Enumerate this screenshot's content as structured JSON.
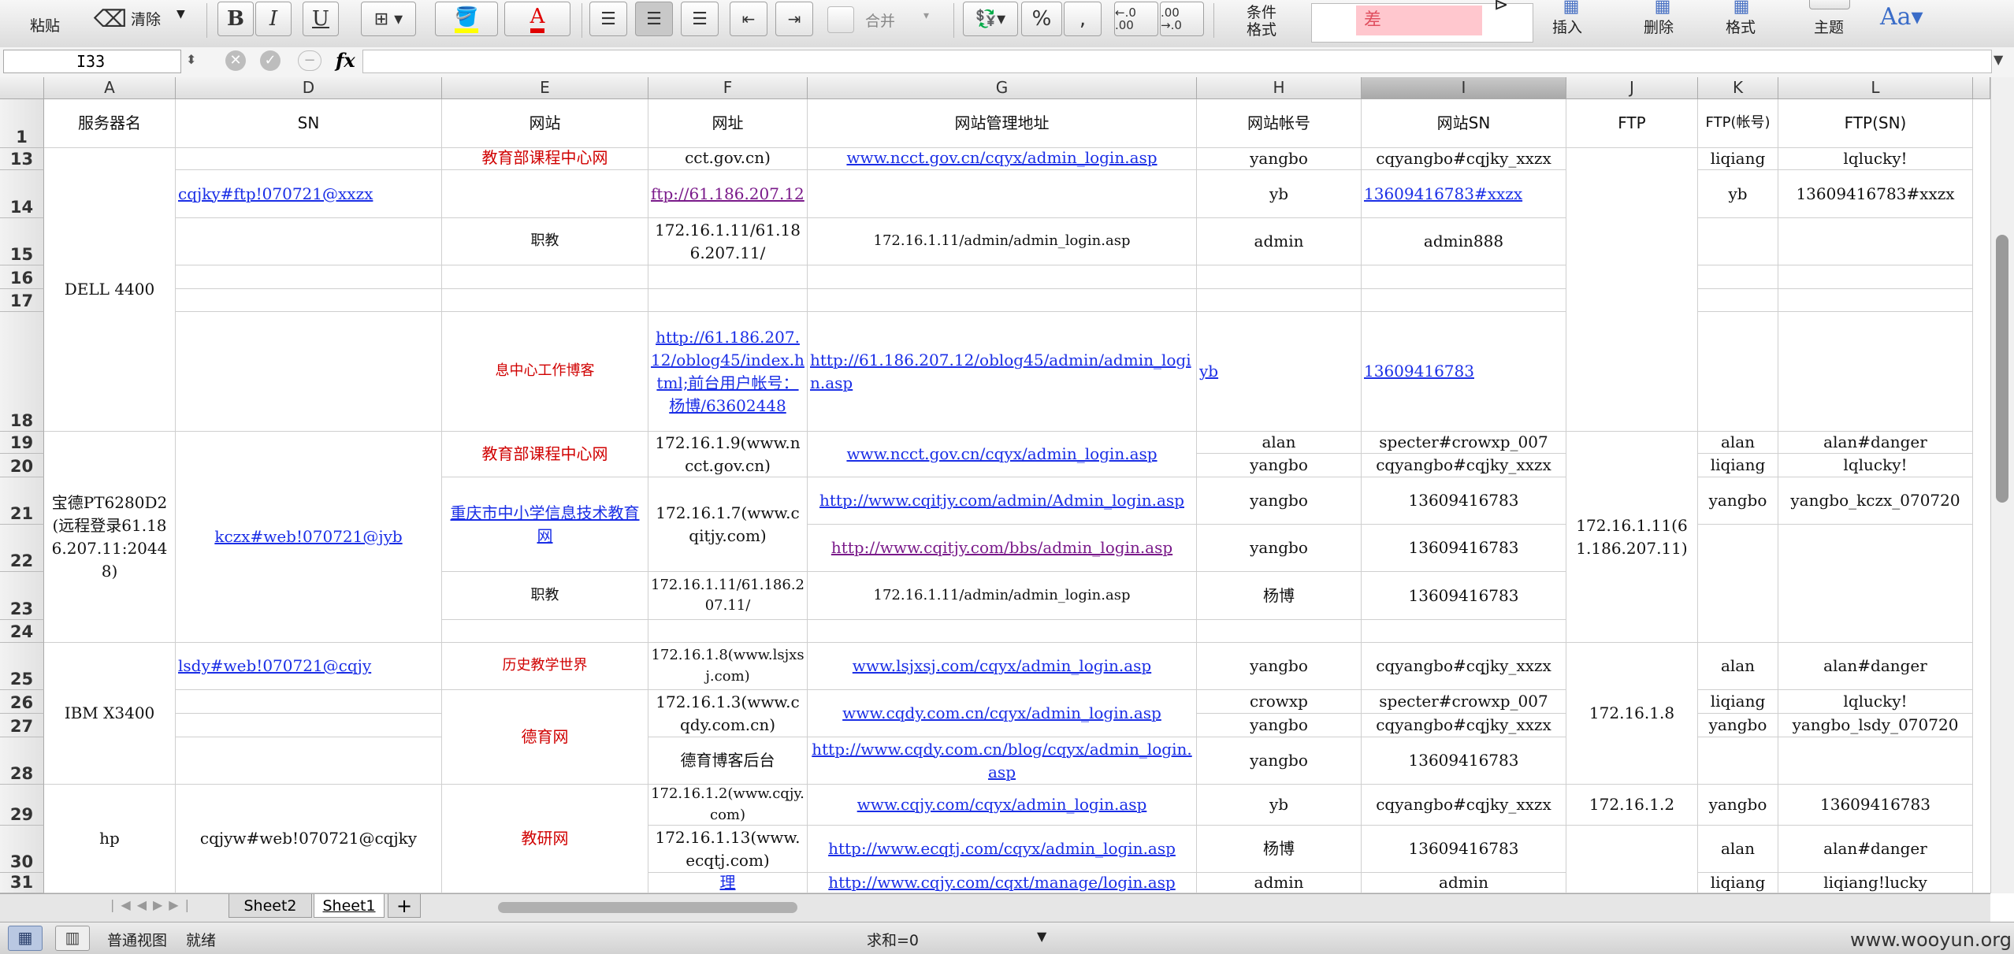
{
  "ribbon": {
    "paste": "粘贴",
    "clear": "清除",
    "bold": "B",
    "italic": "I",
    "underline": "U",
    "font_color_glyph": "A",
    "percent": "%",
    "comma": ",",
    "dec_inc": "←.0 .00",
    "dec_dec": ".00 →.0",
    "merge": "合并",
    "cond_format": "条件\n格式",
    "style_bad": "差",
    "insert": "插入",
    "delete": "删除",
    "format": "格式",
    "theme": "主题",
    "font_theme": "Aa▾",
    "colors": {
      "bad_fill": "#ffc7ce",
      "bad_text": "#9c0006",
      "fill_yellow": "#ffff00",
      "font_red": "#e00000"
    }
  },
  "formula_bar": {
    "cell_ref": "I33",
    "fx": "fx",
    "content": ""
  },
  "columns": [
    {
      "letter": "A",
      "header": "服务器名"
    },
    {
      "letter": "D",
      "header": "SN"
    },
    {
      "letter": "E",
      "header": "网站"
    },
    {
      "letter": "F",
      "header": "网址"
    },
    {
      "letter": "G",
      "header": "网站管理地址"
    },
    {
      "letter": "H",
      "header": "网站帐号"
    },
    {
      "letter": "I",
      "header": "网站SN"
    },
    {
      "letter": "J",
      "header": "FTP"
    },
    {
      "letter": "K",
      "header": "FTP(帐号)"
    },
    {
      "letter": "L",
      "header": "FTP(SN)"
    }
  ],
  "rows": [
    "1",
    "13",
    "14",
    "15",
    "16",
    "17",
    "18",
    "19",
    "20",
    "21",
    "22",
    "23",
    "24",
    "25",
    "26",
    "27",
    "28",
    "29",
    "30",
    "31"
  ],
  "cells": {
    "r13_E": "教育部课程中心网",
    "r13_F": "cct.gov.cn)",
    "r13_G": "www.ncct.gov.cn/cqyx/admin_login.asp",
    "r13_H": "yangbo",
    "r13_I": "cqyangbo#cqjky_xxzx",
    "r13_K": "liqiang",
    "r13_L": "lqlucky!",
    "A_dell": "DELL 4400",
    "r14_D": "cqjky#ftp!070721@xxzx",
    "r14_F": "ftp://61.186.207.12",
    "r14_H": "yb",
    "r14_I": "13609416783#xxzx",
    "r14_K": "yb",
    "r14_L": "13609416783#xxzx",
    "r15_E": "职教",
    "r15_F": "172.16.1.11/61.186.207.11/",
    "r15_G": "172.16.1.11/admin/admin_login.asp",
    "r15_H": "admin",
    "r15_I": "admin888",
    "r18_E": "息中心工作博客",
    "r18_F": "http://61.186.207.12/oblog45/index.html;前台用户帐号：杨博/63602448",
    "r18_G": "http://61.186.207.12/oblog45/admin/admin_login.asp",
    "r18_H": "yb",
    "r18_I": "13609416783",
    "A_baode": "宝德PT6280D2(远程登录61.186.207.11:20448)",
    "D_baode": "kczx#web!070721@jyb",
    "r19_E": "教育部课程中心网",
    "r19_F": "172.16.1.9(www.ncct.gov.cn)",
    "r19_G": "www.ncct.gov.cn/cqyx/admin_login.asp",
    "r19_H": "alan",
    "r19_I": "specter#crowxp_007",
    "r19_K": "alan",
    "r19_L": "alan#danger",
    "r20_H": "yangbo",
    "r20_I": "cqyangbo#cqjky_xxzx",
    "r20_K": "liqiang",
    "r20_L": "lqlucky!",
    "J_baode": "172.16.1.11(61.186.207.11)",
    "r21_E": "重庆市中小学信息技术教育网",
    "r21_F": "172.16.1.7(www.cqitjy.com)",
    "r21_G": "http://www.cqitjy.com/admin/Admin_login.asp",
    "r21_H": "yangbo",
    "r21_I": "13609416783",
    "r21_K": "yangbo",
    "r21_L": "yangbo_kczx_070720",
    "r22_G": "http://www.cqitjy.com/bbs/admin_login.asp",
    "r22_H": "yangbo",
    "r22_I": "13609416783",
    "r23_E": "职教",
    "r23_F": "172.16.1.11/61.186.207.11/",
    "r23_G": "172.16.1.11/admin/admin_login.asp",
    "r23_H": "杨博",
    "r23_I": "13609416783",
    "A_ibm": "IBM X3400",
    "r25_D": "lsdy#web!070721@cqjy",
    "r25_E": "历史教学世界",
    "r25_F": "172.16.1.8(www.lsjxsj.com)",
    "r25_G": "www.lsjxsj.com/cqyx/admin_login.asp",
    "r25_H": "yangbo",
    "r25_I": "cqyangbo#cqjky_xxzx",
    "r25_K": "alan",
    "r25_L": "alan#danger",
    "E_deyu": "德育网",
    "r26_F": "172.16.1.3(www.cqdy.com.cn)",
    "r26_G": "www.cqdy.com.cn/cqyx/admin_login.asp",
    "r26_H": "crowxp",
    "r26_I": "specter#crowxp_007",
    "r26_K": "liqiang",
    "r26_L": "lqlucky!",
    "J_ibm": "172.16.1.8",
    "r27_H": "yangbo",
    "r27_I": "cqyangbo#cqjky_xxzx",
    "r27_K": "yangbo",
    "r27_L": "yangbo_lsdy_070720",
    "r28_F": "德育博客后台",
    "r28_G": "http://www.cqdy.com.cn/blog/cqyx/admin_login.asp",
    "r28_H": "yangbo",
    "r28_I": "13609416783",
    "A_hp": "hp",
    "D_hp": "cqjyw#web!070721@cqjky",
    "E_jiaoyan": "教研网",
    "r29_F": "172.16.1.2(www.cqjy.com)",
    "r29_G": "www.cqjy.com/cqyx/admin_login.asp",
    "r29_H": "yb",
    "r29_I": "cqyangbo#cqjky_xxzx",
    "r29_J": "172.16.1.2",
    "r29_K": "yangbo",
    "r29_L": "13609416783",
    "r30_F": "172.16.1.13(www.ecqtj.com)",
    "r30_G": "http://www.ecqtj.com/cqyx/admin_login.asp",
    "r30_H": "杨博",
    "r30_I": "13609416783",
    "r30_K": "alan",
    "r30_L": "alan#danger",
    "r31_F": "理",
    "r31_G": "http://www.cqjy.com/cqxt/manage/login.asp",
    "r31_H": "admin",
    "r31_I": "admin",
    "r31_K": "liqiang",
    "r31_L": "liqiang!lucky"
  },
  "sheets": {
    "tab1": "Sheet2",
    "tab2": "Sheet1",
    "add": "+"
  },
  "status": {
    "view": "普通视图",
    "ready": "就绪",
    "sum": "求和=0",
    "watermark": "www.wooyun.org"
  }
}
